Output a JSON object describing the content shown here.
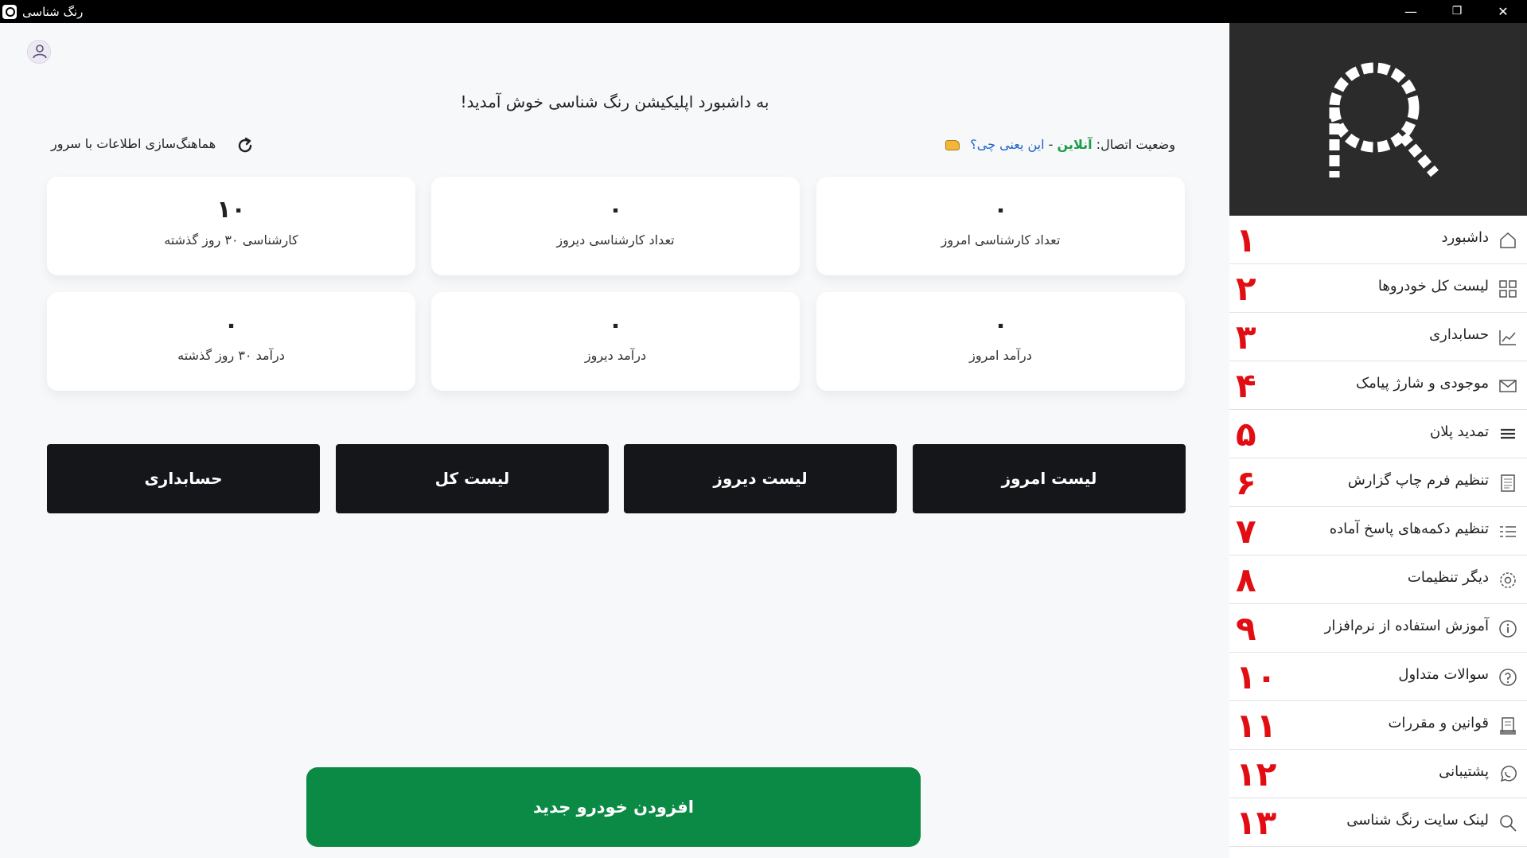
{
  "window": {
    "title": "رنگ شناسی",
    "minimize": "—",
    "restore": "❐",
    "close": "✕"
  },
  "header": {
    "welcome": "به داشبورد اپلیکیشن رنگ شناسی خوش آمدید!",
    "status_prefix": "وضعیت اتصال:",
    "status_value": "آنلاین",
    "status_sep": " - ",
    "status_help": "این یعنی چی؟",
    "sync_label": "هماهنگ‌سازی اطلاعات با سرور"
  },
  "cards": [
    {
      "value": "۰",
      "label": "تعداد کارشناسی امروز"
    },
    {
      "value": "۰",
      "label": "تعداد کارشناسی دیروز"
    },
    {
      "value": "۱۰",
      "label": "کارشناسی ۳۰ روز گذشته"
    },
    {
      "value": "۰",
      "label": "درآمد امروز"
    },
    {
      "value": "۰",
      "label": "درآمد دیروز"
    },
    {
      "value": "۰",
      "label": "درآمد ۳۰ روز گذشته"
    }
  ],
  "buttons": {
    "today_list": "لیست امروز",
    "yesterday_list": "لیست دیروز",
    "full_list": "لیست کل",
    "accounting": "حسابداری",
    "add_car": "افزودن خودرو جدید"
  },
  "sidebar": {
    "items": [
      {
        "num": "۱",
        "label": "داشبورد",
        "icon": "home-icon"
      },
      {
        "num": "۲",
        "label": "لیست کل خودروها",
        "icon": "grid-icon"
      },
      {
        "num": "۳",
        "label": "حسابداری",
        "icon": "chart-icon"
      },
      {
        "num": "۴",
        "label": "موجودی و شارژ پیامک",
        "icon": "mail-icon"
      },
      {
        "num": "۵",
        "label": "تمدید پلان",
        "icon": "list-icon"
      },
      {
        "num": "۶",
        "label": "تنظیم فرم چاپ گزارش",
        "icon": "document-icon"
      },
      {
        "num": "۷",
        "label": "تنظیم دکمه‌های پاسخ آماده",
        "icon": "checklist-icon"
      },
      {
        "num": "۸",
        "label": "دیگر تنظیمات",
        "icon": "gear-icon"
      },
      {
        "num": "۹",
        "label": "آموزش استفاده از نرم‌افزار",
        "icon": "info-icon"
      },
      {
        "num": "۱۰",
        "label": "سوالات متداول",
        "icon": "question-icon"
      },
      {
        "num": "۱۱",
        "label": "قوانین و مقررات",
        "icon": "rules-icon"
      },
      {
        "num": "۱۲",
        "label": "پشتیبانی",
        "icon": "whatsapp-icon"
      },
      {
        "num": "۱۳",
        "label": "لینک سایت رنگ شناسی",
        "icon": "search-icon"
      }
    ]
  },
  "colors": {
    "accent_green": "#0b8a45",
    "dark_button": "#141619",
    "marker_red": "#e10d12",
    "online_green": "#1b9d4a",
    "link_blue": "#1d63c9"
  }
}
